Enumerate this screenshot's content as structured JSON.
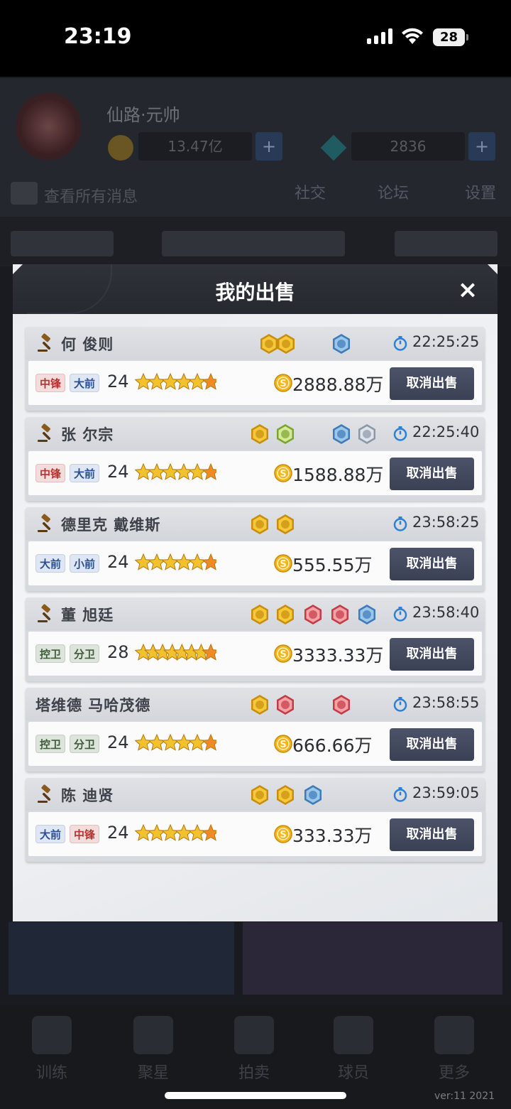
{
  "status_bar": {
    "time": "23:19",
    "battery": "28"
  },
  "background": {
    "player_name": "仙路·元帅",
    "coins": "13.47亿",
    "gems": "2836",
    "message_label": "查看所有消息",
    "side_buttons": [
      "社交",
      "论坛",
      "设置"
    ],
    "nav_items": [
      "训练",
      "聚星",
      "拍卖",
      "球员",
      "更多"
    ],
    "version": "ver:11  2021"
  },
  "modal": {
    "title": "我的出售",
    "close_icon": "×",
    "cancel_label": "取消出售",
    "listings": [
      {
        "name": "何 俊则",
        "positions": [
          {
            "label": "中锋",
            "color": "red"
          },
          {
            "label": "大前",
            "color": "blue"
          }
        ],
        "age": "24",
        "price": "2888.88万",
        "time": "22:25:25",
        "gavel": true
      },
      {
        "name": "张 尔宗",
        "positions": [
          {
            "label": "中锋",
            "color": "red"
          },
          {
            "label": "大前",
            "color": "blue"
          }
        ],
        "age": "24",
        "price": "1588.88万",
        "time": "22:25:40",
        "gavel": true
      },
      {
        "name": "德里克 戴维斯",
        "positions": [
          {
            "label": "大前",
            "color": "blue"
          },
          {
            "label": "小前",
            "color": "blue"
          }
        ],
        "age": "24",
        "price": "555.55万",
        "time": "23:58:25",
        "gavel": true
      },
      {
        "name": "董 旭廷",
        "positions": [
          {
            "label": "控卫",
            "color": "green"
          },
          {
            "label": "分卫",
            "color": "green"
          }
        ],
        "age": "28",
        "price": "3333.33万",
        "time": "23:58:40",
        "gavel": true
      },
      {
        "name": "塔维德 马哈茂德",
        "positions": [
          {
            "label": "控卫",
            "color": "green"
          },
          {
            "label": "分卫",
            "color": "green"
          }
        ],
        "age": "24",
        "price": "666.66万",
        "time": "23:58:55",
        "gavel": false
      },
      {
        "name": "陈 迪贤",
        "positions": [
          {
            "label": "大前",
            "color": "blue"
          },
          {
            "label": "中锋",
            "color": "red"
          }
        ],
        "age": "24",
        "price": "333.33万",
        "time": "23:59:05",
        "gavel": true
      }
    ]
  },
  "colors": {
    "gold": "#f2b51c",
    "button": "#41475a",
    "star_orange": "#f08a24"
  }
}
